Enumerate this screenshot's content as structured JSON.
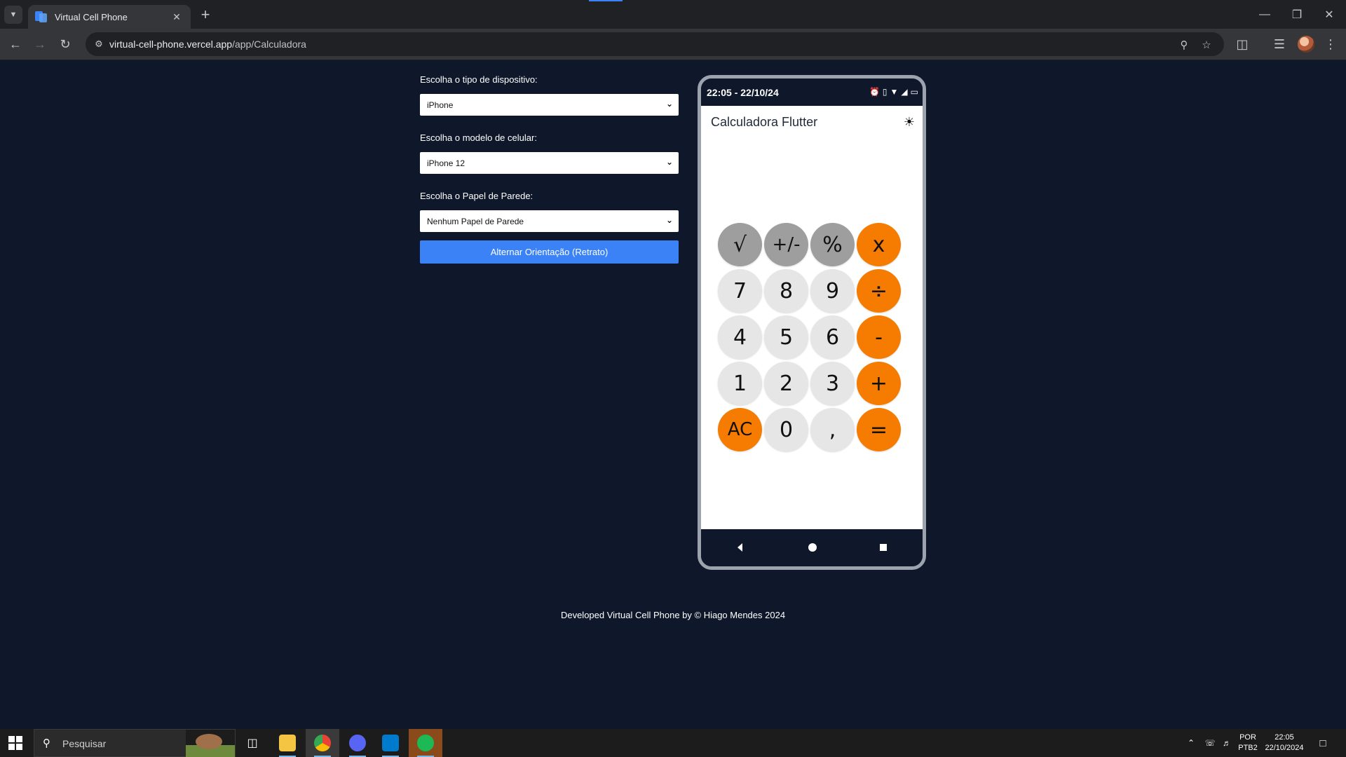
{
  "browser": {
    "tab_title": "Virtual Cell Phone",
    "url_host": "virtual-cell-phone.vercel.app",
    "url_path": "/app/Calculadora"
  },
  "panel": {
    "device_type_label": "Escolha o tipo de dispositivo:",
    "device_type_value": "iPhone",
    "model_label": "Escolha o modelo de celular:",
    "model_value": "iPhone 12",
    "wallpaper_label": "Escolha o Papel de Parede:",
    "wallpaper_value": "Nenhum Papel de Parede",
    "orientation_button": "Alternar Orientação (Retrato)"
  },
  "phone": {
    "status_time": "22:05 - 22/10/24",
    "app_title": "Calculadora Flutter",
    "keys": [
      {
        "label": "√",
        "kind": "fn"
      },
      {
        "label": "+/-",
        "kind": "fn"
      },
      {
        "label": "%",
        "kind": "fn"
      },
      {
        "label": "x",
        "kind": "op"
      },
      {
        "label": "7",
        "kind": "num"
      },
      {
        "label": "8",
        "kind": "num"
      },
      {
        "label": "9",
        "kind": "num"
      },
      {
        "label": "÷",
        "kind": "op"
      },
      {
        "label": "4",
        "kind": "num"
      },
      {
        "label": "5",
        "kind": "num"
      },
      {
        "label": "6",
        "kind": "num"
      },
      {
        "label": "-",
        "kind": "op"
      },
      {
        "label": "1",
        "kind": "num"
      },
      {
        "label": "2",
        "kind": "num"
      },
      {
        "label": "3",
        "kind": "num"
      },
      {
        "label": "+",
        "kind": "op"
      },
      {
        "label": "AC",
        "kind": "op"
      },
      {
        "label": "0",
        "kind": "num"
      },
      {
        "label": ",",
        "kind": "num"
      },
      {
        "label": "=",
        "kind": "op"
      }
    ]
  },
  "footer": {
    "text": "Developed Virtual Cell Phone by © Hiago Mendes 2024"
  },
  "taskbar": {
    "search_placeholder": "Pesquisar",
    "lang_top": "POR",
    "lang_bottom": "PTB2",
    "clock_time": "22:05",
    "clock_date": "22/10/2024"
  },
  "colors": {
    "page_bg": "#0f172a",
    "accent_blue": "#3b82f6",
    "key_operator": "#f57c00",
    "key_function": "#9e9e9e",
    "key_number": "#e6e6e6"
  }
}
